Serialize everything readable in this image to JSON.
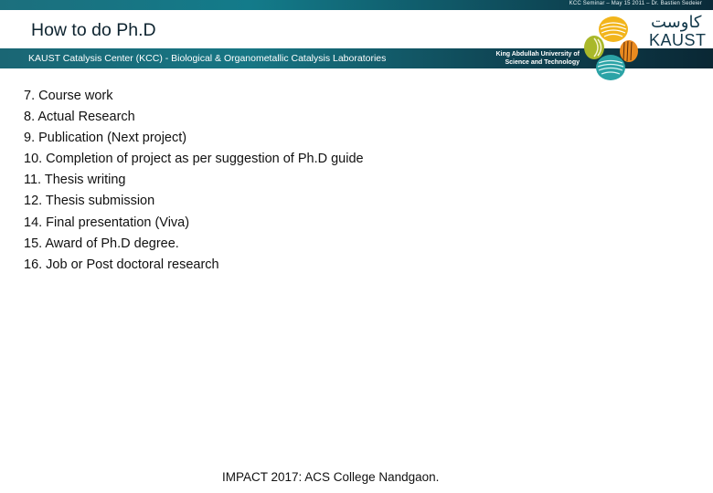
{
  "header": {
    "meta_line": "KCC Seminar – May 15 2011 – Dr. Bastien Sedeier",
    "title": "How to do Ph.D",
    "subtitle": "KAUST Catalysis Center (KCC)  -  Biological & Organometallic Catalysis Laboratories",
    "university_line1": "King Abdullah University of",
    "university_line2": "Science and Technology"
  },
  "logo": {
    "arabic": "كاوست",
    "text": "KAUST",
    "colors": {
      "yellow": "#f2b51c",
      "lime": "#a9b82a",
      "orange": "#ea8a1f",
      "teal": "#2ba3a6"
    }
  },
  "content": {
    "items": [
      "7. Course work",
      "8. Actual Research",
      "9. Publication (Next project)",
      "10. Completion of project as per suggestion of Ph.D guide",
      "11. Thesis writing",
      "12. Thesis submission",
      "14. Final presentation (Viva)",
      "15. Award of  Ph.D degree.",
      "16. Job or Post doctoral research"
    ]
  },
  "footer": {
    "text": "IMPACT 2017: ACS College Nandgaon."
  },
  "theme": {
    "band_start": "#1a6674",
    "band_end": "#0a2734"
  }
}
